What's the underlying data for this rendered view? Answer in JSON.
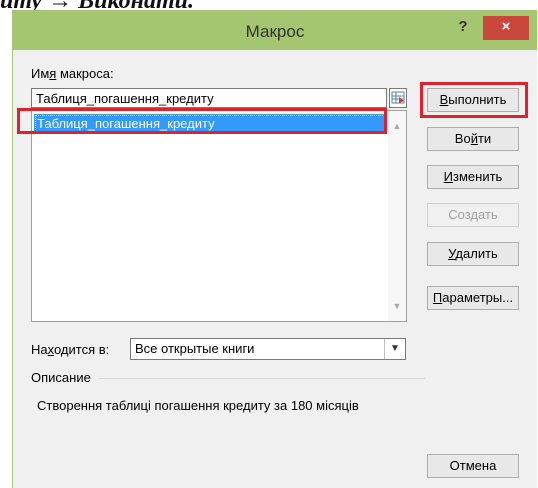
{
  "caption": {
    "text": "иту → Виконати."
  },
  "window": {
    "title": "Макрос",
    "help_glyph": "?",
    "close_glyph": "×"
  },
  "macro_name": {
    "label_pre": "Им",
    "label_ul": "я",
    "label_post": " макроса:",
    "value": "Таблиця_погашення_кредиту"
  },
  "macro_list": {
    "items": [
      "Таблиця_погашення_кредиту"
    ],
    "scroll_up": "▲",
    "scroll_down": "▼"
  },
  "buttons": {
    "run": {
      "pre": "",
      "ul": "В",
      "post": "ыполнить"
    },
    "step": {
      "pre": "Во",
      "ul": "й",
      "post": "ти"
    },
    "edit": {
      "pre": "",
      "ul": "И",
      "post": "зменить"
    },
    "create": {
      "label": "Создать"
    },
    "delete": {
      "pre": "",
      "ul": "У",
      "post": "далить"
    },
    "options": {
      "pre": "",
      "ul": "П",
      "post": "араметры..."
    },
    "cancel": {
      "label": "Отмена"
    }
  },
  "location": {
    "label_pre": "На",
    "label_ul": "х",
    "label_post": "одится в:",
    "value": "Все открытые книги",
    "arrow": "▼"
  },
  "description": {
    "label": "Описание",
    "text": "Створення таблиці погашення кредиту за 180 місяців"
  },
  "colors": {
    "titlebar": "#a5c670",
    "close": "#c9483b",
    "selection": "#3399ff",
    "highlight": "#e0232a"
  }
}
